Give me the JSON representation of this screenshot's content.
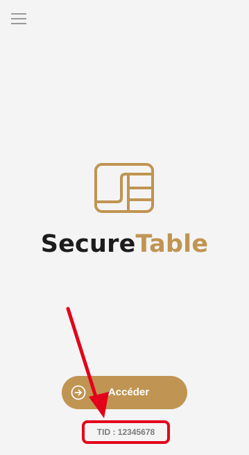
{
  "header": {
    "menu_icon": "hamburger-menu-icon"
  },
  "logo": {
    "icon": "table-layout-icon",
    "brand_part1": "Secure",
    "brand_part2": "Table",
    "brand_color": "#c09452",
    "text_color": "#1c1c1c"
  },
  "actions": {
    "access_label": "Accéder",
    "access_icon": "arrow-right-circle-icon"
  },
  "footer": {
    "tid_text": "TID : 12345678"
  },
  "annotation": {
    "arrow_color": "#e3001b",
    "box_color": "#e3001b"
  }
}
